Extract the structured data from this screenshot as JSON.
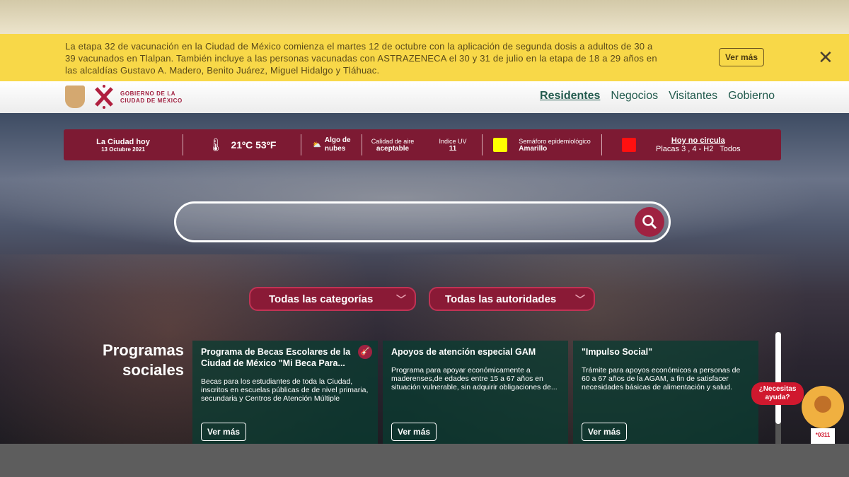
{
  "alert": {
    "text": "La etapa 32 de vacunación en la Ciudad de México comienza el martes 12 de octubre con la aplicación de segunda dosis a adultos de 30 a 39 vacunados en Tlalpan. También incluye a las personas vacunadas con ASTRAZENECA el 30 y 31 de julio en la etapa de 18 a 29 años en las alcaldías Gustavo A. Madero, Benito Juárez, Miguel Hidalgo y Tláhuac.",
    "button": "Ver más",
    "close_icon": "close-icon"
  },
  "header": {
    "logo_line1": "GOBIERNO DE LA",
    "logo_line2": "CIUDAD DE MÉXICO",
    "menu": [
      "Residentes",
      "Negocios",
      "Visitantes",
      "Gobierno"
    ],
    "active": "Residentes"
  },
  "weather": {
    "city_today": "La Ciudad hoy",
    "date": "13 Octubre 2021",
    "temperature": "21ºC 53ºF",
    "sky_line1": "Algo de",
    "sky_line2": "nubes",
    "air_label": "Calidad de aire",
    "air_value": "aceptable",
    "uv_label": "Indice UV",
    "uv_value": "11",
    "semaforo_label": "Semáforo epidemiológico",
    "semaforo_value": "Amarillo",
    "semaforo_color": "#ffff00",
    "hnc_label": "Hoy no circula",
    "hnc_value": "Placas 3 , 4 - H2   Todos",
    "hnc_color": "#ff1010"
  },
  "search": {
    "placeholder": "",
    "icon": "search-icon"
  },
  "filters": {
    "categories": "Todas las categorías",
    "authorities": "Todas las autoridades"
  },
  "programs": {
    "title_line1": "Programas",
    "title_line2": "sociales",
    "cards": [
      {
        "title": "Programa de Becas Escolares de la Ciudad de México \"Mi Beca Para...",
        "desc": "Becas para los estudiantes de toda la Ciudad, inscritos en escuelas públicas de de nivel primaria, secundaria y Centros de Atención Múltiple",
        "button": "Ver más"
      },
      {
        "title": "Apoyos de atención especial GAM",
        "desc": "Programa para apoyar económicamente a maderenses,de edades entre 15 a 67 años en situación vulnerable, sin adquirir obligaciones de...",
        "button": "Ver más"
      },
      {
        "title": "\"Impulso Social\"",
        "desc": "Trámite para apoyos económicos a personas de 60 a 67 años de la AGAM, a fin de satisfacer necesidades básicas de alimentación y salud.",
        "button": "Ver más"
      }
    ]
  },
  "help": {
    "line1": "¿Necesitas",
    "line2": "ayuda?",
    "avatar_text": "*0311"
  }
}
